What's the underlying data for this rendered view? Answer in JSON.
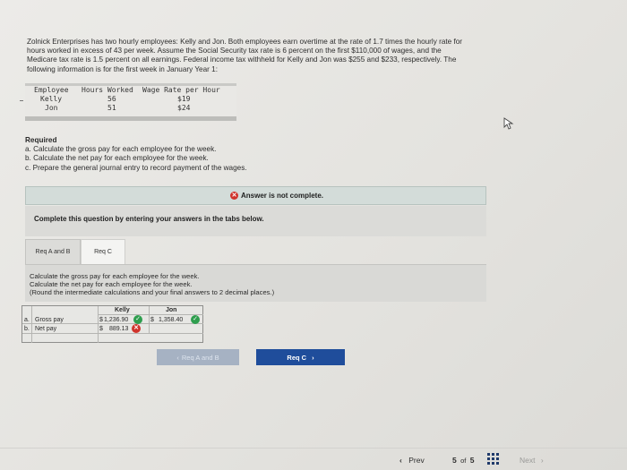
{
  "problem": {
    "lines": [
      "Zolnick Enterprises has two hourly employees: Kelly and Jon. Both employees earn overtime at the rate of 1.7 times the hourly rate for",
      "hours worked in excess of 43 per week. Assume the Social Security tax rate is 6 percent on the first $110,000 of wages, and the",
      "Medicare tax rate is 1.5 percent on all earnings. Federal income tax withheld for Kelly and Jon was $255 and $233, respectively. The",
      "following information is for the first week in January Year 1:"
    ]
  },
  "employee_table": {
    "headers": [
      "Employee",
      "Hours Worked",
      "Wage Rate per Hour"
    ],
    "rows": [
      [
        "Kelly",
        "56",
        "$19"
      ],
      [
        "Jon",
        "51",
        "$24"
      ]
    ]
  },
  "required": {
    "heading": "Required",
    "items": [
      "a. Calculate the gross pay for each employee for the week.",
      "b. Calculate the net pay for each employee for the week.",
      "c. Prepare the general journal entry to record payment of the wages."
    ]
  },
  "status": {
    "text": "Answer is not complete.",
    "icon": "x-circle-icon",
    "color": "#d0342c"
  },
  "instructions": "Complete this question by entering your answers in the tabs below.",
  "tabs": [
    {
      "label": "Req A and B",
      "active": true
    },
    {
      "label": "Req C",
      "active": false
    }
  ],
  "content": {
    "lines": [
      "Calculate the gross pay for each employee for the week.",
      "Calculate the net pay for each employee for the week.",
      "(Round the intermediate calculations and your final answers to 2 decimal places.)"
    ]
  },
  "answer_table": {
    "columns": [
      "Kelly",
      "Jon"
    ],
    "rows": [
      {
        "letter": "a.",
        "label": "Gross pay",
        "kelly_prefix": "$",
        "kelly": "1,236.90",
        "kelly_status": "correct",
        "jon_prefix": "$",
        "jon": "1,358.40",
        "jon_status": "correct"
      },
      {
        "letter": "b.",
        "label": "Net pay",
        "kelly_prefix": "$",
        "kelly": "889.13",
        "kelly_status": "incorrect",
        "jon_prefix": "",
        "jon": "",
        "jon_status": ""
      }
    ]
  },
  "nav_buttons": {
    "prev_label": "Req A and B",
    "next_label": "Req C"
  },
  "footer": {
    "prev": "Prev",
    "page_current": "5",
    "page_of": "of",
    "page_total": "5",
    "next": "Next"
  },
  "colors": {
    "primary_button": "#1f4d9b",
    "correct": "#2e9e4e",
    "incorrect": "#d0342c"
  }
}
